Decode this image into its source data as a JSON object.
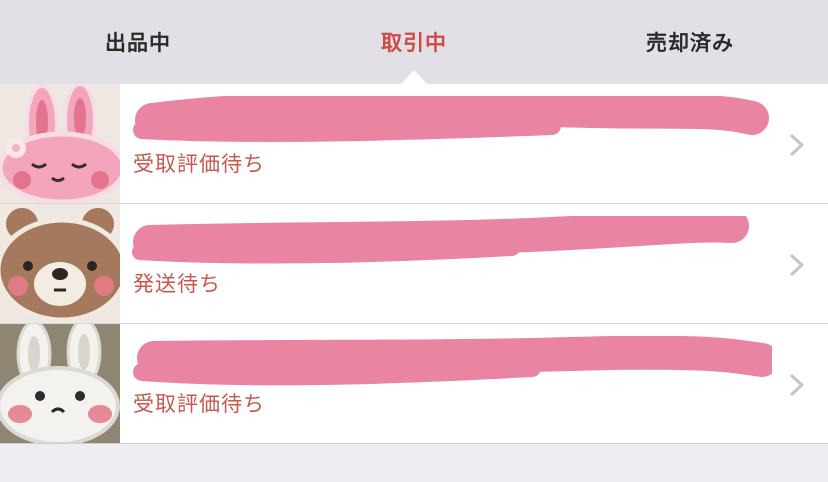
{
  "tabs": [
    {
      "label": "出品中",
      "active": false
    },
    {
      "label": "取引中",
      "active": true
    },
    {
      "label": "売却済み",
      "active": false
    }
  ],
  "items": [
    {
      "title": "",
      "status": "受取評価待ち",
      "thumbnail_icon": "pink-bunny-sticker"
    },
    {
      "title": "",
      "status": "発送待ち",
      "thumbnail_icon": "brown-bear-sticker"
    },
    {
      "title": "",
      "status": "受取評価待ち",
      "thumbnail_icon": "white-bunny-sticker"
    }
  ],
  "colors": {
    "active_tab": "#cf4a45",
    "status_text": "#c9574d",
    "redaction": "#ea84a3",
    "tabbar_bg": "#e2e0e6"
  }
}
